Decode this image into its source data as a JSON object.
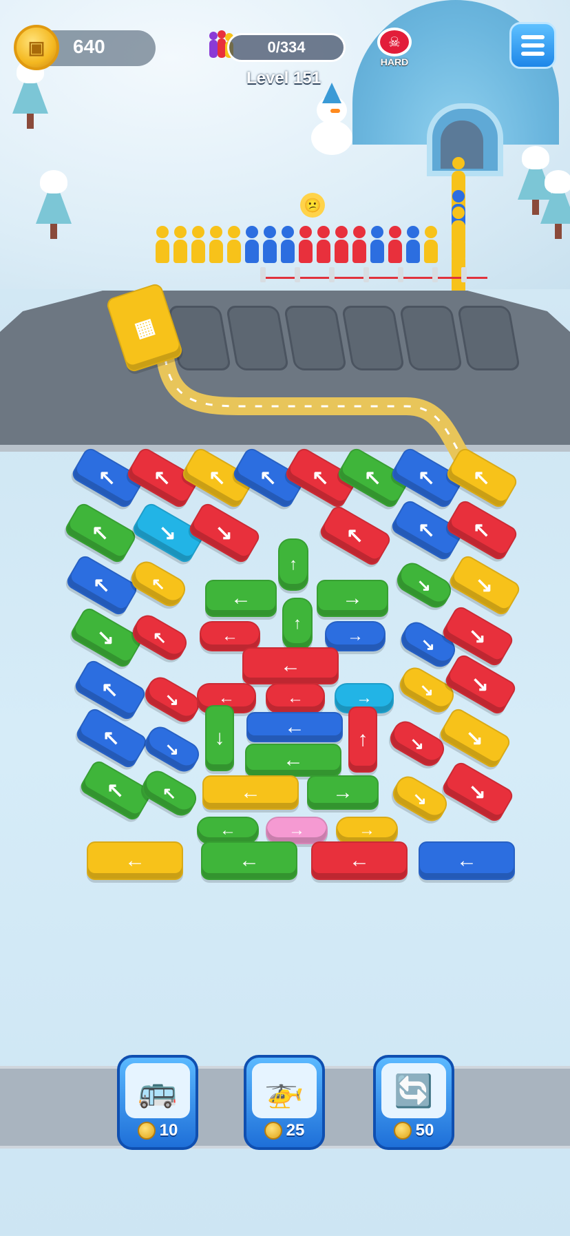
{
  "hud": {
    "coins": "640",
    "progress": "0/334",
    "level": "Level 151",
    "difficulty": "HARD"
  },
  "boosters": [
    {
      "name": "repaint-bus",
      "icon": "🚌",
      "price": "10"
    },
    {
      "name": "helicopter",
      "icon": "🚁",
      "price": "25"
    },
    {
      "name": "shuffle-people",
      "icon": "🔄",
      "price": "50"
    }
  ],
  "colors": {
    "blue": "#2c6ee0",
    "red": "#e8303c",
    "yellow": "#f7c21a",
    "green": "#3fb53a",
    "cyan": "#22b4e6",
    "pink": "#f59ad2"
  },
  "queue_colors": [
    "yellow",
    "yellow",
    "yellow",
    "yellow",
    "yellow",
    "blue",
    "blue",
    "blue",
    "red",
    "red",
    "red",
    "red",
    "blue",
    "red",
    "blue",
    "yellow"
  ],
  "side_queue_colors": [
    "yellow",
    "yellow",
    "blue",
    "yellow",
    "yellow",
    "yellow",
    "yellow"
  ],
  "vehicles": [
    {
      "c": "blue",
      "t": "bus",
      "a": "↖"
    },
    {
      "c": "red",
      "t": "bus",
      "a": "↖"
    },
    {
      "c": "yellow",
      "t": "bus",
      "a": "↖"
    },
    {
      "c": "blue",
      "t": "bus",
      "a": "↖"
    },
    {
      "c": "red",
      "t": "bus",
      "a": "↖"
    },
    {
      "c": "green",
      "t": "bus",
      "a": "↖"
    },
    {
      "c": "blue",
      "t": "bus",
      "a": "↖"
    },
    {
      "c": "yellow",
      "t": "bus",
      "a": "↖"
    },
    {
      "c": "green",
      "t": "bus",
      "a": "↖"
    },
    {
      "c": "cyan",
      "t": "bus",
      "a": "↘"
    },
    {
      "c": "red",
      "t": "bus",
      "a": "↘"
    },
    {
      "c": "green",
      "t": "car",
      "a": "↑"
    },
    {
      "c": "red",
      "t": "bus",
      "a": "↖"
    },
    {
      "c": "blue",
      "t": "bus",
      "a": "↖"
    },
    {
      "c": "red",
      "t": "bus",
      "a": "↖"
    },
    {
      "c": "blue",
      "t": "bus",
      "a": "↖"
    },
    {
      "c": "yellow",
      "t": "car",
      "a": "↖"
    },
    {
      "c": "green",
      "t": "bus",
      "a": "←"
    },
    {
      "c": "green",
      "t": "bus",
      "a": "→"
    },
    {
      "c": "green",
      "t": "car",
      "a": "↘"
    },
    {
      "c": "yellow",
      "t": "bus",
      "a": "↘"
    },
    {
      "c": "green",
      "t": "bus",
      "a": "↘"
    },
    {
      "c": "red",
      "t": "car",
      "a": "↖"
    },
    {
      "c": "red",
      "t": "car",
      "a": "←"
    },
    {
      "c": "green",
      "t": "car",
      "a": "↑"
    },
    {
      "c": "blue",
      "t": "car",
      "a": "→"
    },
    {
      "c": "blue",
      "t": "car",
      "a": "↘"
    },
    {
      "c": "red",
      "t": "bus",
      "a": "↘"
    },
    {
      "c": "red",
      "t": "bus",
      "a": "←"
    },
    {
      "c": "blue",
      "t": "bus",
      "a": "↖"
    },
    {
      "c": "red",
      "t": "car",
      "a": "↘"
    },
    {
      "c": "red",
      "t": "car",
      "a": "←"
    },
    {
      "c": "red",
      "t": "car",
      "a": "←"
    },
    {
      "c": "cyan",
      "t": "car",
      "a": "→"
    },
    {
      "c": "yellow",
      "t": "car",
      "a": "↘"
    },
    {
      "c": "red",
      "t": "bus",
      "a": "↘"
    },
    {
      "c": "green",
      "t": "bus",
      "a": "↓"
    },
    {
      "c": "blue",
      "t": "bus",
      "a": "←"
    },
    {
      "c": "red",
      "t": "bus",
      "a": "↑"
    },
    {
      "c": "blue",
      "t": "bus",
      "a": "↖"
    },
    {
      "c": "blue",
      "t": "car",
      "a": "↘"
    },
    {
      "c": "green",
      "t": "bus",
      "a": "←"
    },
    {
      "c": "red",
      "t": "car",
      "a": "↘"
    },
    {
      "c": "yellow",
      "t": "bus",
      "a": "↘"
    },
    {
      "c": "green",
      "t": "bus",
      "a": "↖"
    },
    {
      "c": "green",
      "t": "car",
      "a": "↖"
    },
    {
      "c": "yellow",
      "t": "bus",
      "a": "←"
    },
    {
      "c": "green",
      "t": "bus",
      "a": "→"
    },
    {
      "c": "yellow",
      "t": "car",
      "a": "↘"
    },
    {
      "c": "red",
      "t": "bus",
      "a": "↘"
    },
    {
      "c": "green",
      "t": "car",
      "a": "←"
    },
    {
      "c": "pink",
      "t": "car",
      "a": "→"
    },
    {
      "c": "yellow",
      "t": "car",
      "a": "→"
    },
    {
      "c": "yellow",
      "t": "bus",
      "a": "←"
    },
    {
      "c": "green",
      "t": "bus",
      "a": "←"
    },
    {
      "c": "red",
      "t": "bus",
      "a": "←"
    },
    {
      "c": "blue",
      "t": "bus",
      "a": "←"
    }
  ],
  "parked_bus": {
    "c": "yellow"
  }
}
